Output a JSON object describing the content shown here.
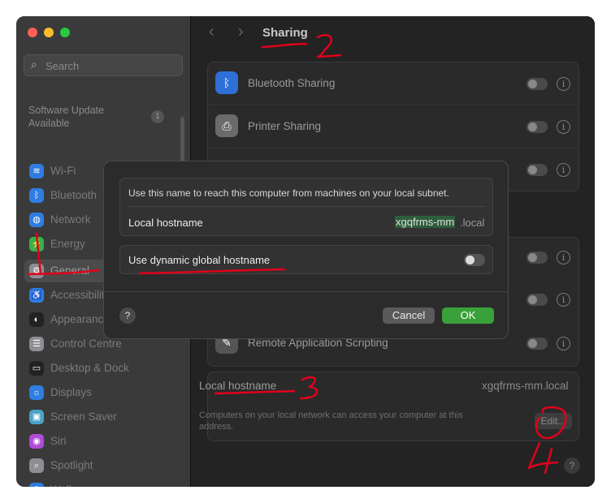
{
  "window": {
    "traffic_lights": [
      {
        "name": "close",
        "color": "#ff5f57"
      },
      {
        "name": "minimize",
        "color": "#febc2e"
      },
      {
        "name": "zoom",
        "color": "#28c840"
      }
    ]
  },
  "sidebar": {
    "search_placeholder": "Search",
    "software_update": {
      "label": "Software Update Available",
      "badge": "1"
    },
    "items": [
      {
        "label": "Wi-Fi",
        "icon": "wifi-icon",
        "color": "#2f7de1"
      },
      {
        "label": "Bluetooth",
        "icon": "bluetooth-icon",
        "color": "#2f7de1"
      },
      {
        "label": "Network",
        "icon": "network-icon",
        "color": "#2f7de1"
      },
      {
        "label": "Energy",
        "icon": "energy-icon",
        "color": "#38b04b"
      },
      {
        "label": "General",
        "icon": "gear-icon",
        "color": "#8e8e93"
      },
      {
        "label": "Accessibility",
        "icon": "accessibility-icon",
        "color": "#2f7de1"
      },
      {
        "label": "Appearance",
        "icon": "appearance-icon",
        "color": "#222222"
      },
      {
        "label": "Control Centre",
        "icon": "control-centre-icon",
        "color": "#8e8e93"
      },
      {
        "label": "Desktop & Dock",
        "icon": "desktop-dock-icon",
        "color": "#222222"
      },
      {
        "label": "Displays",
        "icon": "displays-icon",
        "color": "#2f7de1"
      },
      {
        "label": "Screen Saver",
        "icon": "screen-saver-icon",
        "color": "#4aa3c7"
      },
      {
        "label": "Siri",
        "icon": "siri-icon",
        "color": "#b04bd8"
      },
      {
        "label": "Spotlight",
        "icon": "spotlight-icon",
        "color": "#8e8e93"
      },
      {
        "label": "Wallpaper",
        "icon": "wallpaper-icon",
        "color": "#2f7de1"
      }
    ]
  },
  "header": {
    "back": "‹",
    "forward": "›",
    "title": "Sharing"
  },
  "sharing": {
    "rows": [
      {
        "label": "Bluetooth Sharing",
        "icon": "bluetooth-icon",
        "enabled": false
      },
      {
        "label": "Printer Sharing",
        "icon": "printer-icon",
        "enabled": false
      },
      {
        "label": "Remote Application Scripting",
        "icon": "script-icon",
        "enabled": false
      }
    ],
    "local_hostname": {
      "label": "Local hostname",
      "value": "xgqfrms-mm.local",
      "description": "Computers on your local network can access your computer at this address.",
      "edit_label": "Edit..."
    },
    "help": "?"
  },
  "dialog": {
    "info": "Use this name to reach this computer from machines on your local subnet.",
    "hostname_label": "Local hostname",
    "hostname_value": "xgqfrms-mm",
    "hostname_suffix": ".local",
    "dynamic_label": "Use dynamic global hostname",
    "dynamic_enabled": false,
    "help": "?",
    "cancel": "Cancel",
    "ok": "OK"
  },
  "annotations": {
    "color": "#e0001b",
    "marks": [
      "1",
      "2",
      "3",
      "4"
    ]
  }
}
